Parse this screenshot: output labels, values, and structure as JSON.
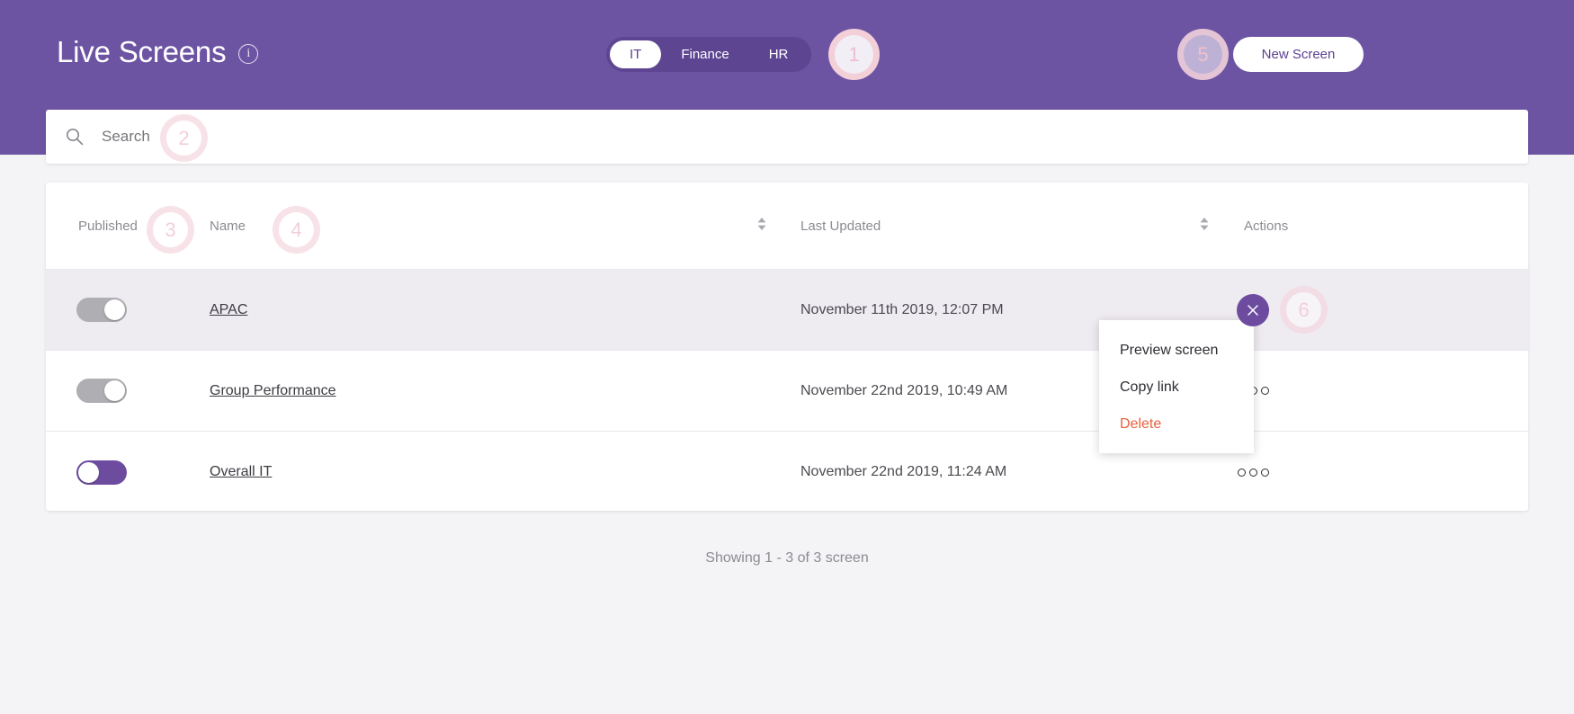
{
  "header": {
    "title": "Live Screens",
    "info_icon": "info-icon",
    "new_screen_label": "New Screen",
    "brand_purple": "#6d54a3",
    "tabs": [
      {
        "label": "IT",
        "active": true
      },
      {
        "label": "Finance",
        "active": false
      },
      {
        "label": "HR",
        "active": false
      }
    ]
  },
  "search": {
    "icon": "search-icon",
    "placeholder": "Search",
    "value": ""
  },
  "table": {
    "columns": {
      "published": "Published",
      "name": "Name",
      "last_updated": "Last Updated",
      "actions": "Actions"
    },
    "rows": [
      {
        "published": false,
        "name": "APAC",
        "last_updated": "November 11th 2019, 12:07 PM",
        "actions_icon": "more-options-icon",
        "highlighted": true
      },
      {
        "published": false,
        "name": "Group Performance",
        "last_updated": "November 22nd 2019, 10:49 AM",
        "actions_icon": "more-options-icon",
        "highlighted": false
      },
      {
        "published": true,
        "name": "Overall IT",
        "last_updated": "November 22nd 2019, 11:24 AM",
        "actions_icon": "more-options-icon",
        "highlighted": false
      }
    ]
  },
  "dropdown": {
    "items": [
      {
        "label": "Preview screen",
        "danger": false
      },
      {
        "label": "Copy link",
        "danger": false
      },
      {
        "label": "Delete",
        "danger": true
      }
    ],
    "close_icon": "close-icon",
    "danger_color": "#e9603c"
  },
  "footer": {
    "showing": "Showing 1 - 3 of 3 screen"
  },
  "annotations": {
    "badges": [
      "1",
      "2",
      "3",
      "4",
      "5",
      "6"
    ],
    "color": "#f2cfd9"
  }
}
